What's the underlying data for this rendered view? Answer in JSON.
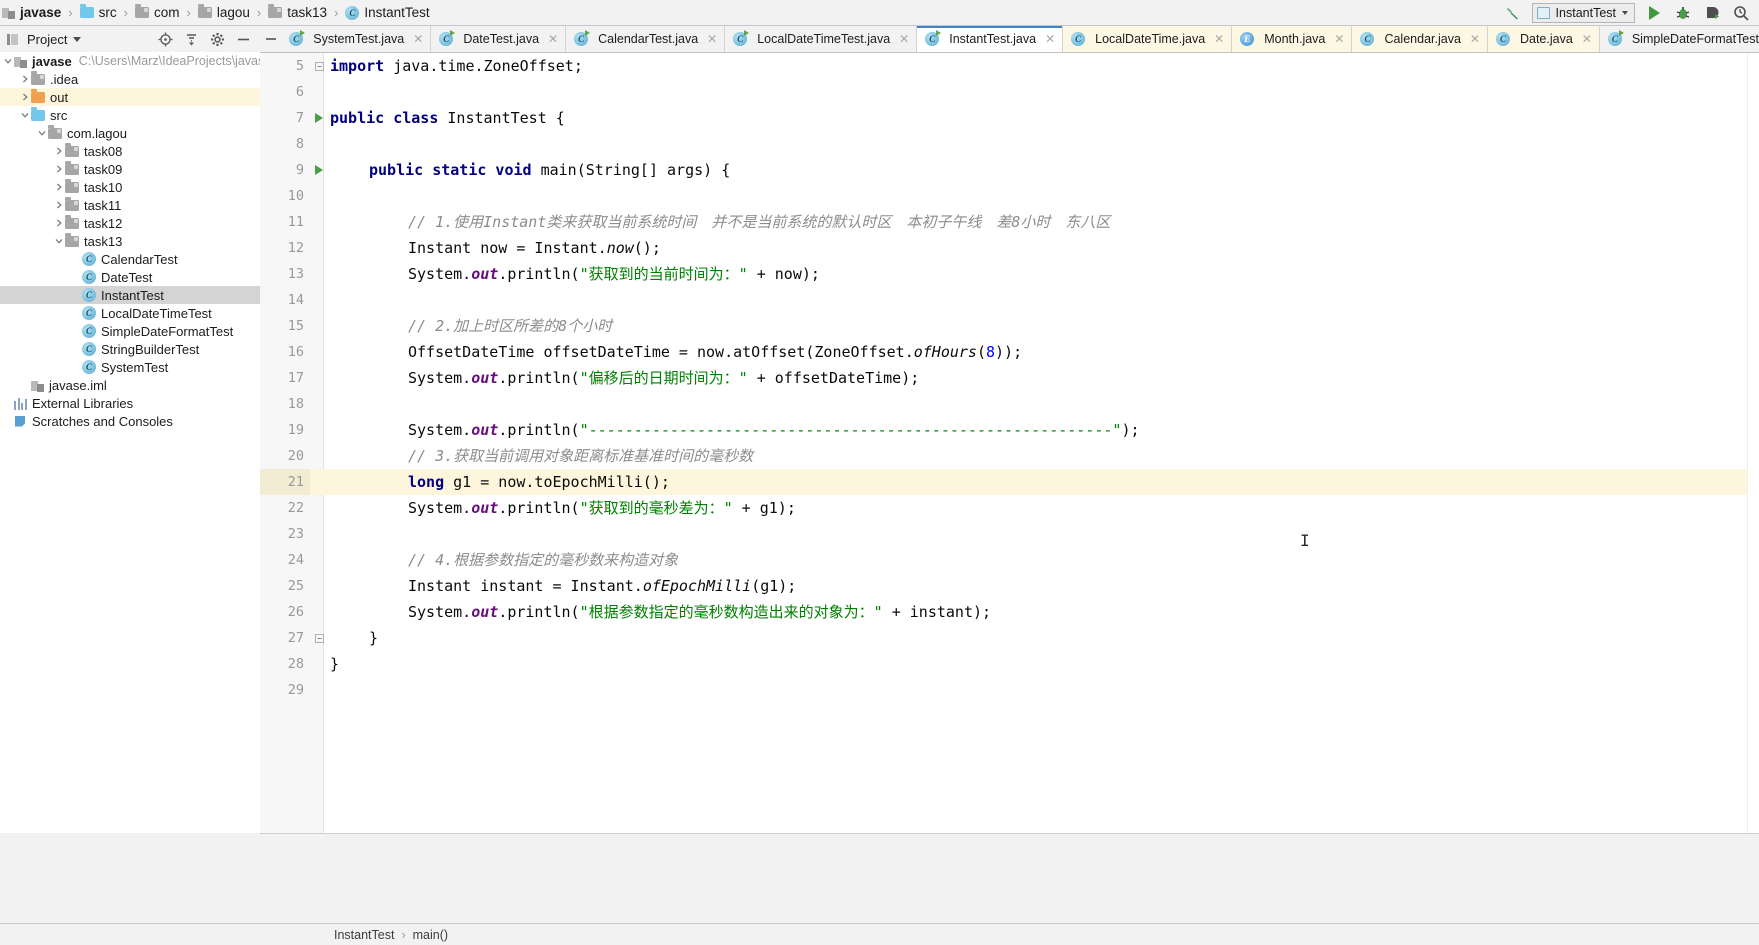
{
  "window": {
    "app": "IntelliJ IDEA",
    "breadcrumb": [
      {
        "label": "javase",
        "icon": "module-icon",
        "bold": true
      },
      {
        "label": "src",
        "icon": "source-folder-icon",
        "bold": false
      },
      {
        "label": "com",
        "icon": "folder-icon",
        "bold": false
      },
      {
        "label": "lagou",
        "icon": "folder-icon",
        "bold": false
      },
      {
        "label": "task13",
        "icon": "folder-icon",
        "bold": false
      },
      {
        "label": "InstantTest",
        "icon": "java-class-icon",
        "bold": false
      }
    ]
  },
  "toolbar": {
    "build_icon": "hammer-icon",
    "run_config": "InstantTest",
    "run_config_icon": "run-configuration-icon",
    "dropdown_icon": "chevron-down-icon",
    "run_icon": "run-icon",
    "debug_icon": "debug-bug-icon",
    "run_coverage_icon": "run-with-coverage-icon",
    "profiler_icon": "profiler-icon"
  },
  "project_panel": {
    "title": "Project",
    "title_caret": "chevron-down-icon",
    "actions": [
      {
        "name": "locate-icon"
      },
      {
        "name": "collapse-all-icon"
      },
      {
        "name": "settings-gear-icon"
      },
      {
        "name": "hide-panel-icon"
      }
    ],
    "tree": [
      {
        "depth": 0,
        "arrow": "down",
        "icon": "module-icon",
        "label": "javase",
        "path": "C:\\Users\\Marz\\IdeaProjects\\javase",
        "bold": true,
        "state": "none"
      },
      {
        "depth": 1,
        "arrow": "right",
        "icon": "folder-gray-icon",
        "label": ".idea",
        "state": "none"
      },
      {
        "depth": 1,
        "arrow": "right",
        "icon": "folder-orange-icon",
        "label": "out",
        "state": "highlight"
      },
      {
        "depth": 1,
        "arrow": "down",
        "icon": "source-folder-icon",
        "label": "src",
        "state": "none"
      },
      {
        "depth": 2,
        "arrow": "down",
        "icon": "package-icon",
        "label": "com.lagou",
        "state": "none"
      },
      {
        "depth": 3,
        "arrow": "right",
        "icon": "package-icon",
        "label": "task08",
        "state": "none"
      },
      {
        "depth": 3,
        "arrow": "right",
        "icon": "package-icon",
        "label": "task09",
        "state": "none"
      },
      {
        "depth": 3,
        "arrow": "right",
        "icon": "package-icon",
        "label": "task10",
        "state": "none"
      },
      {
        "depth": 3,
        "arrow": "right",
        "icon": "package-icon",
        "label": "task11",
        "state": "none"
      },
      {
        "depth": 3,
        "arrow": "right",
        "icon": "package-icon",
        "label": "task12",
        "state": "none"
      },
      {
        "depth": 3,
        "arrow": "down",
        "icon": "package-icon",
        "label": "task13",
        "state": "none"
      },
      {
        "depth": 4,
        "arrow": "none",
        "icon": "java-class-icon",
        "label": "CalendarTest",
        "state": "none"
      },
      {
        "depth": 4,
        "arrow": "none",
        "icon": "java-class-icon",
        "label": "DateTest",
        "state": "none"
      },
      {
        "depth": 4,
        "arrow": "none",
        "icon": "java-class-icon",
        "label": "InstantTest",
        "state": "selected"
      },
      {
        "depth": 4,
        "arrow": "none",
        "icon": "java-class-icon",
        "label": "LocalDateTimeTest",
        "state": "none"
      },
      {
        "depth": 4,
        "arrow": "none",
        "icon": "java-class-icon",
        "label": "SimpleDateFormatTest",
        "state": "none"
      },
      {
        "depth": 4,
        "arrow": "none",
        "icon": "java-class-icon",
        "label": "StringBuilderTest",
        "state": "none"
      },
      {
        "depth": 4,
        "arrow": "none",
        "icon": "java-class-icon",
        "label": "SystemTest",
        "state": "none"
      },
      {
        "depth": 1,
        "arrow": "none",
        "icon": "iml-file-icon",
        "label": "javase.iml",
        "state": "none"
      },
      {
        "depth": 0,
        "arrow": "none",
        "icon": "external-libraries-icon",
        "label": "External Libraries",
        "state": "none"
      },
      {
        "depth": 0,
        "arrow": "none",
        "icon": "scratches-icon",
        "label": "Scratches and Consoles",
        "state": "none"
      }
    ]
  },
  "editor_tabs": {
    "collapse_icon": "hide-tabs-icon",
    "close_icon": "close-icon",
    "items": [
      {
        "label": "SystemTest.java",
        "icon": "java-class-runnable-icon",
        "active": false,
        "library": false
      },
      {
        "label": "DateTest.java",
        "icon": "java-class-runnable-icon",
        "active": false,
        "library": false
      },
      {
        "label": "CalendarTest.java",
        "icon": "java-class-runnable-icon",
        "active": false,
        "library": false
      },
      {
        "label": "LocalDateTimeTest.java",
        "icon": "java-class-runnable-icon",
        "active": false,
        "library": false
      },
      {
        "label": "InstantTest.java",
        "icon": "java-class-runnable-icon",
        "active": true,
        "library": false
      },
      {
        "label": "LocalDateTime.java",
        "icon": "java-class-icon",
        "active": false,
        "library": true
      },
      {
        "label": "Month.java",
        "icon": "java-enum-icon",
        "active": false,
        "library": true
      },
      {
        "label": "Calendar.java",
        "icon": "java-class-icon",
        "active": false,
        "library": true
      },
      {
        "label": "Date.java",
        "icon": "java-class-icon",
        "active": false,
        "library": true
      },
      {
        "label": "SimpleDateFormatTest.java",
        "icon": "java-class-runnable-icon",
        "active": false,
        "library": false
      }
    ]
  },
  "code": {
    "first_line_number": 5,
    "caret_line": 21,
    "lines": [
      {
        "n": 5,
        "gutter": "fold",
        "indent": 0,
        "tokens": [
          {
            "t": "kw",
            "v": "import"
          },
          {
            "t": "p",
            "v": " java.time.ZoneOffset;"
          }
        ]
      },
      {
        "n": 6,
        "gutter": "",
        "indent": 0,
        "tokens": []
      },
      {
        "n": 7,
        "gutter": "run",
        "indent": 0,
        "tokens": [
          {
            "t": "kw",
            "v": "public class"
          },
          {
            "t": "p",
            "v": " InstantTest {"
          }
        ]
      },
      {
        "n": 8,
        "gutter": "",
        "indent": 0,
        "tokens": []
      },
      {
        "n": 9,
        "gutter": "run",
        "indent": 1,
        "tokens": [
          {
            "t": "kw",
            "v": "public static void"
          },
          {
            "t": "p",
            "v": " main(String[] args) {"
          }
        ]
      },
      {
        "n": 10,
        "gutter": "",
        "indent": 0,
        "tokens": []
      },
      {
        "n": 11,
        "gutter": "",
        "indent": 2,
        "tokens": [
          {
            "t": "cmt",
            "v": "// 1.使用Instant类来获取当前系统时间　并不是当前系统的默认时区　本初子午线　差8小时　东八区"
          }
        ]
      },
      {
        "n": 12,
        "gutter": "",
        "indent": 2,
        "tokens": [
          {
            "t": "p",
            "v": "Instant now = Instant."
          },
          {
            "t": "mth",
            "v": "now"
          },
          {
            "t": "p",
            "v": "();"
          }
        ]
      },
      {
        "n": 13,
        "gutter": "",
        "indent": 2,
        "tokens": [
          {
            "t": "p",
            "v": "System."
          },
          {
            "t": "fld",
            "v": "out"
          },
          {
            "t": "p",
            "v": ".println("
          },
          {
            "t": "str",
            "v": "\"获取到的当前时间为："
          },
          {
            "t": "str",
            "v": "\""
          },
          {
            "t": "p",
            "v": " + now);"
          }
        ]
      },
      {
        "n": 14,
        "gutter": "",
        "indent": 0,
        "tokens": []
      },
      {
        "n": 15,
        "gutter": "",
        "indent": 2,
        "tokens": [
          {
            "t": "cmt",
            "v": "// 2.加上时区所差的8个小时"
          }
        ]
      },
      {
        "n": 16,
        "gutter": "",
        "indent": 2,
        "tokens": [
          {
            "t": "p",
            "v": "OffsetDateTime offsetDateTime = now.atOffset(ZoneOffset."
          },
          {
            "t": "mth",
            "v": "ofHours"
          },
          {
            "t": "p",
            "v": "("
          },
          {
            "t": "num",
            "v": "8"
          },
          {
            "t": "p",
            "v": "));"
          }
        ]
      },
      {
        "n": 17,
        "gutter": "",
        "indent": 2,
        "tokens": [
          {
            "t": "p",
            "v": "System."
          },
          {
            "t": "fld",
            "v": "out"
          },
          {
            "t": "p",
            "v": ".println("
          },
          {
            "t": "str",
            "v": "\"偏移后的日期时间为：\""
          },
          {
            "t": "p",
            "v": " + offsetDateTime);"
          }
        ]
      },
      {
        "n": 18,
        "gutter": "",
        "indent": 0,
        "tokens": []
      },
      {
        "n": 19,
        "gutter": "",
        "indent": 2,
        "tokens": [
          {
            "t": "p",
            "v": "System."
          },
          {
            "t": "fld",
            "v": "out"
          },
          {
            "t": "p",
            "v": ".println("
          },
          {
            "t": "str",
            "v": "\"----------------------------------------------------------\""
          },
          {
            "t": "p",
            "v": ");"
          }
        ]
      },
      {
        "n": 20,
        "gutter": "",
        "indent": 2,
        "tokens": [
          {
            "t": "cmt",
            "v": "// 3.获取当前调用对象距离标准基准时间的毫秒数"
          }
        ]
      },
      {
        "n": 21,
        "gutter": "",
        "indent": 2,
        "highlight": true,
        "tokens": [
          {
            "t": "kw",
            "v": "long"
          },
          {
            "t": "p",
            "v": " g1 = now.toEpochMilli();"
          }
        ]
      },
      {
        "n": 22,
        "gutter": "",
        "indent": 2,
        "tokens": [
          {
            "t": "p",
            "v": "System."
          },
          {
            "t": "fld",
            "v": "out"
          },
          {
            "t": "p",
            "v": ".println("
          },
          {
            "t": "str",
            "v": "\"获取到的毫秒差为：\""
          },
          {
            "t": "p",
            "v": " + g1);"
          }
        ]
      },
      {
        "n": 23,
        "gutter": "",
        "indent": 0,
        "tokens": []
      },
      {
        "n": 24,
        "gutter": "",
        "indent": 2,
        "tokens": [
          {
            "t": "cmt",
            "v": "// 4.根据参数指定的毫秒数来构造对象"
          }
        ]
      },
      {
        "n": 25,
        "gutter": "",
        "indent": 2,
        "tokens": [
          {
            "t": "p",
            "v": "Instant instant = Instant."
          },
          {
            "t": "mth",
            "v": "ofEpochMilli"
          },
          {
            "t": "p",
            "v": "(g1);"
          }
        ]
      },
      {
        "n": 26,
        "gutter": "",
        "indent": 2,
        "tokens": [
          {
            "t": "p",
            "v": "System."
          },
          {
            "t": "fld",
            "v": "out"
          },
          {
            "t": "p",
            "v": ".println("
          },
          {
            "t": "str",
            "v": "\"根据参数指定的毫秒数构造出来的对象为：\""
          },
          {
            "t": "p",
            "v": " + instant);"
          }
        ]
      },
      {
        "n": 27,
        "gutter": "fold",
        "indent": 1,
        "tokens": [
          {
            "t": "p",
            "v": "}"
          }
        ]
      },
      {
        "n": 28,
        "gutter": "",
        "indent": 0,
        "tokens": [
          {
            "t": "p",
            "v": "}"
          }
        ]
      },
      {
        "n": 29,
        "gutter": "",
        "indent": 0,
        "tokens": []
      }
    ]
  },
  "status_navbar": {
    "items": [
      "InstantTest",
      "main()"
    ],
    "separator": "›"
  }
}
